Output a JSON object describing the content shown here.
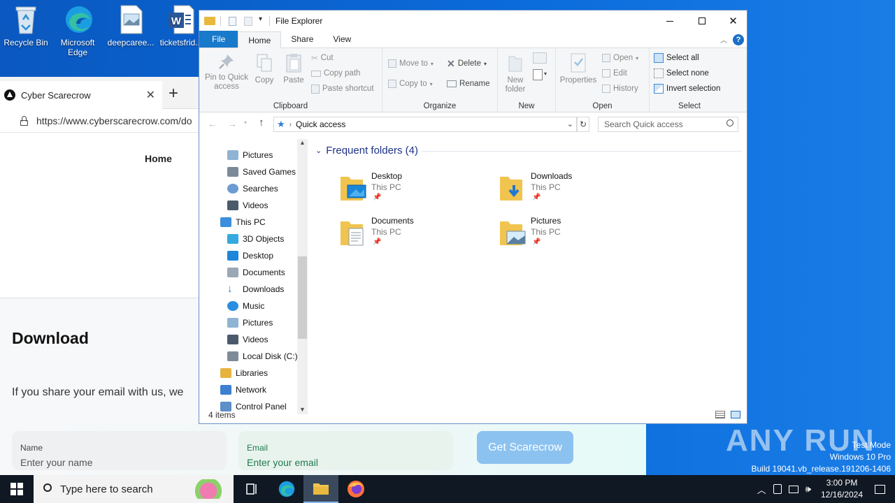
{
  "desktop": {
    "icons": [
      {
        "label": "Recycle Bin"
      },
      {
        "label": "Microsoft Edge"
      },
      {
        "label": "deepcaree..."
      },
      {
        "label": "ticketsfrid..."
      }
    ],
    "watermark": {
      "brand": "ANY RUN",
      "line1": "Test Mode",
      "line2": "Windows 10 Pro",
      "line3": "Build 19041.vb_release.191206-1406"
    }
  },
  "browser": {
    "tab_title": "Cyber Scarecrow",
    "new_tab": "+",
    "url": "https://www.cyberscarecrow.com/do",
    "page": {
      "nav_home": "Home",
      "heading": "Download",
      "text": "If you share your email with us, we",
      "name_label": "Name",
      "name_placeholder": "Enter your name",
      "email_label": "Email",
      "email_placeholder": "Enter your email",
      "cta": "Get Scarecrow"
    }
  },
  "explorer": {
    "title": "File Explorer",
    "ribbon_tabs": [
      "File",
      "Home",
      "Share",
      "View"
    ],
    "help": "?",
    "clipboard": {
      "label": "Clipboard",
      "pin": "Pin to Quick access",
      "copy": "Copy",
      "paste": "Paste",
      "cut": "Cut",
      "copy_path": "Copy path",
      "paste_shortcut": "Paste shortcut"
    },
    "organize": {
      "label": "Organize",
      "move_to": "Move to",
      "copy_to": "Copy to",
      "delete": "Delete",
      "rename": "Rename"
    },
    "new": {
      "label": "New",
      "new_folder": "New folder"
    },
    "open": {
      "label": "Open",
      "properties": "Properties",
      "open": "Open",
      "edit": "Edit",
      "history": "History"
    },
    "select": {
      "label": "Select",
      "select_all": "Select all",
      "select_none": "Select none",
      "invert": "Invert selection"
    },
    "address": {
      "location": "Quick access",
      "search_placeholder": "Search Quick access"
    },
    "nav_items": [
      {
        "label": "Pictures"
      },
      {
        "label": "Saved Games"
      },
      {
        "label": "Searches"
      },
      {
        "label": "Videos"
      },
      {
        "label": "This PC"
      },
      {
        "label": "3D Objects"
      },
      {
        "label": "Desktop"
      },
      {
        "label": "Documents"
      },
      {
        "label": "Downloads"
      },
      {
        "label": "Music"
      },
      {
        "label": "Pictures"
      },
      {
        "label": "Videos"
      },
      {
        "label": "Local Disk (C:)"
      },
      {
        "label": "Libraries"
      },
      {
        "label": "Network"
      },
      {
        "label": "Control Panel"
      }
    ],
    "section_title": "Frequent folders (4)",
    "folders": [
      {
        "name": "Desktop",
        "location": "This PC"
      },
      {
        "name": "Downloads",
        "location": "This PC"
      },
      {
        "name": "Documents",
        "location": "This PC"
      },
      {
        "name": "Pictures",
        "location": "This PC"
      }
    ],
    "status": "4 items"
  },
  "taskbar": {
    "search_placeholder": "Type here to search",
    "time": "3:00 PM",
    "date": "12/16/2024"
  }
}
